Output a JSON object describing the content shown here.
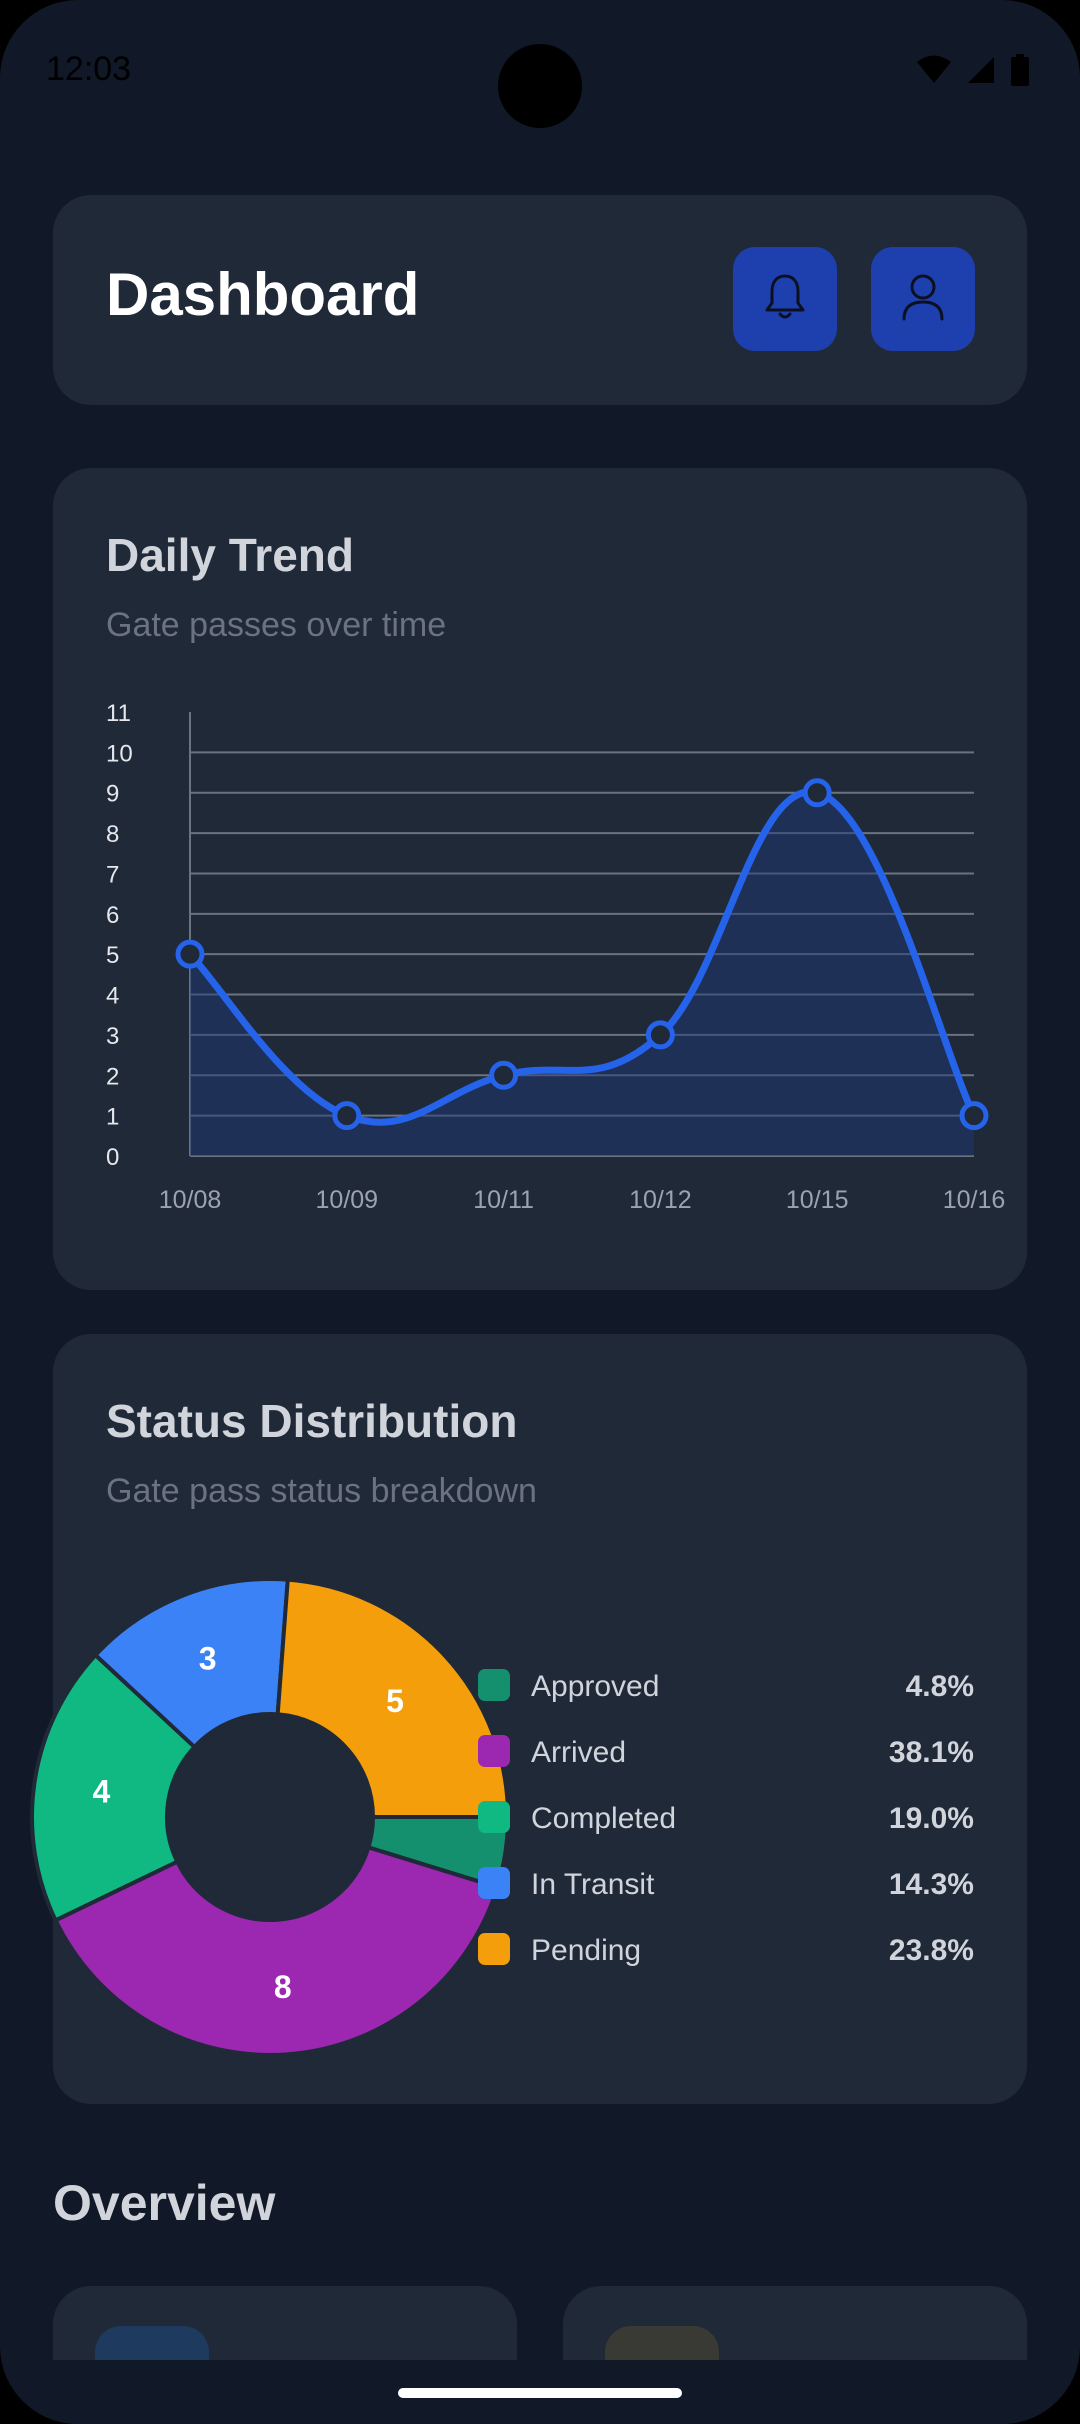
{
  "status_bar": {
    "time": "12:03"
  },
  "header": {
    "title": "Dashboard",
    "notification_icon": "bell-icon",
    "profile_icon": "user-icon"
  },
  "trend": {
    "title": "Daily Trend",
    "subtitle": "Gate passes over time"
  },
  "status": {
    "title": "Status Distribution",
    "subtitle": "Gate pass status breakdown"
  },
  "overview": {
    "title": "Overview"
  },
  "colors": {
    "background": "#111827",
    "card": "#1f2937",
    "accent": "#1e40af",
    "line": "#2563eb",
    "approved": "#15906f",
    "arrived": "#9c27b0",
    "completed": "#10b981",
    "in_transit": "#3b82f6",
    "pending": "#f59e0b"
  },
  "chart_data": [
    {
      "type": "line",
      "x": [
        "10/08",
        "10/09",
        "10/11",
        "10/12",
        "10/15",
        "10/16"
      ],
      "series": [
        {
          "values": [
            5,
            1,
            2,
            3,
            9,
            1
          ]
        }
      ],
      "ylim": [
        0,
        11
      ],
      "yticks": [
        0,
        1,
        2,
        3,
        4,
        5,
        6,
        7,
        8,
        9,
        10,
        11
      ],
      "grid": true,
      "smoothed": true,
      "area_fill": true
    },
    {
      "type": "pie",
      "donut": true,
      "categories": [
        "Approved",
        "Arrived",
        "Completed",
        "In Transit",
        "Pending"
      ],
      "values": [
        1,
        8,
        4,
        3,
        5
      ],
      "percentages": [
        "4.8%",
        "38.1%",
        "19.0%",
        "14.3%",
        "23.8%"
      ],
      "slice_labels": [
        "",
        "8",
        "4",
        "3",
        "5"
      ],
      "colors": [
        "#15906f",
        "#9c27b0",
        "#10b981",
        "#3b82f6",
        "#f59e0b"
      ],
      "legend_position": "right"
    }
  ]
}
